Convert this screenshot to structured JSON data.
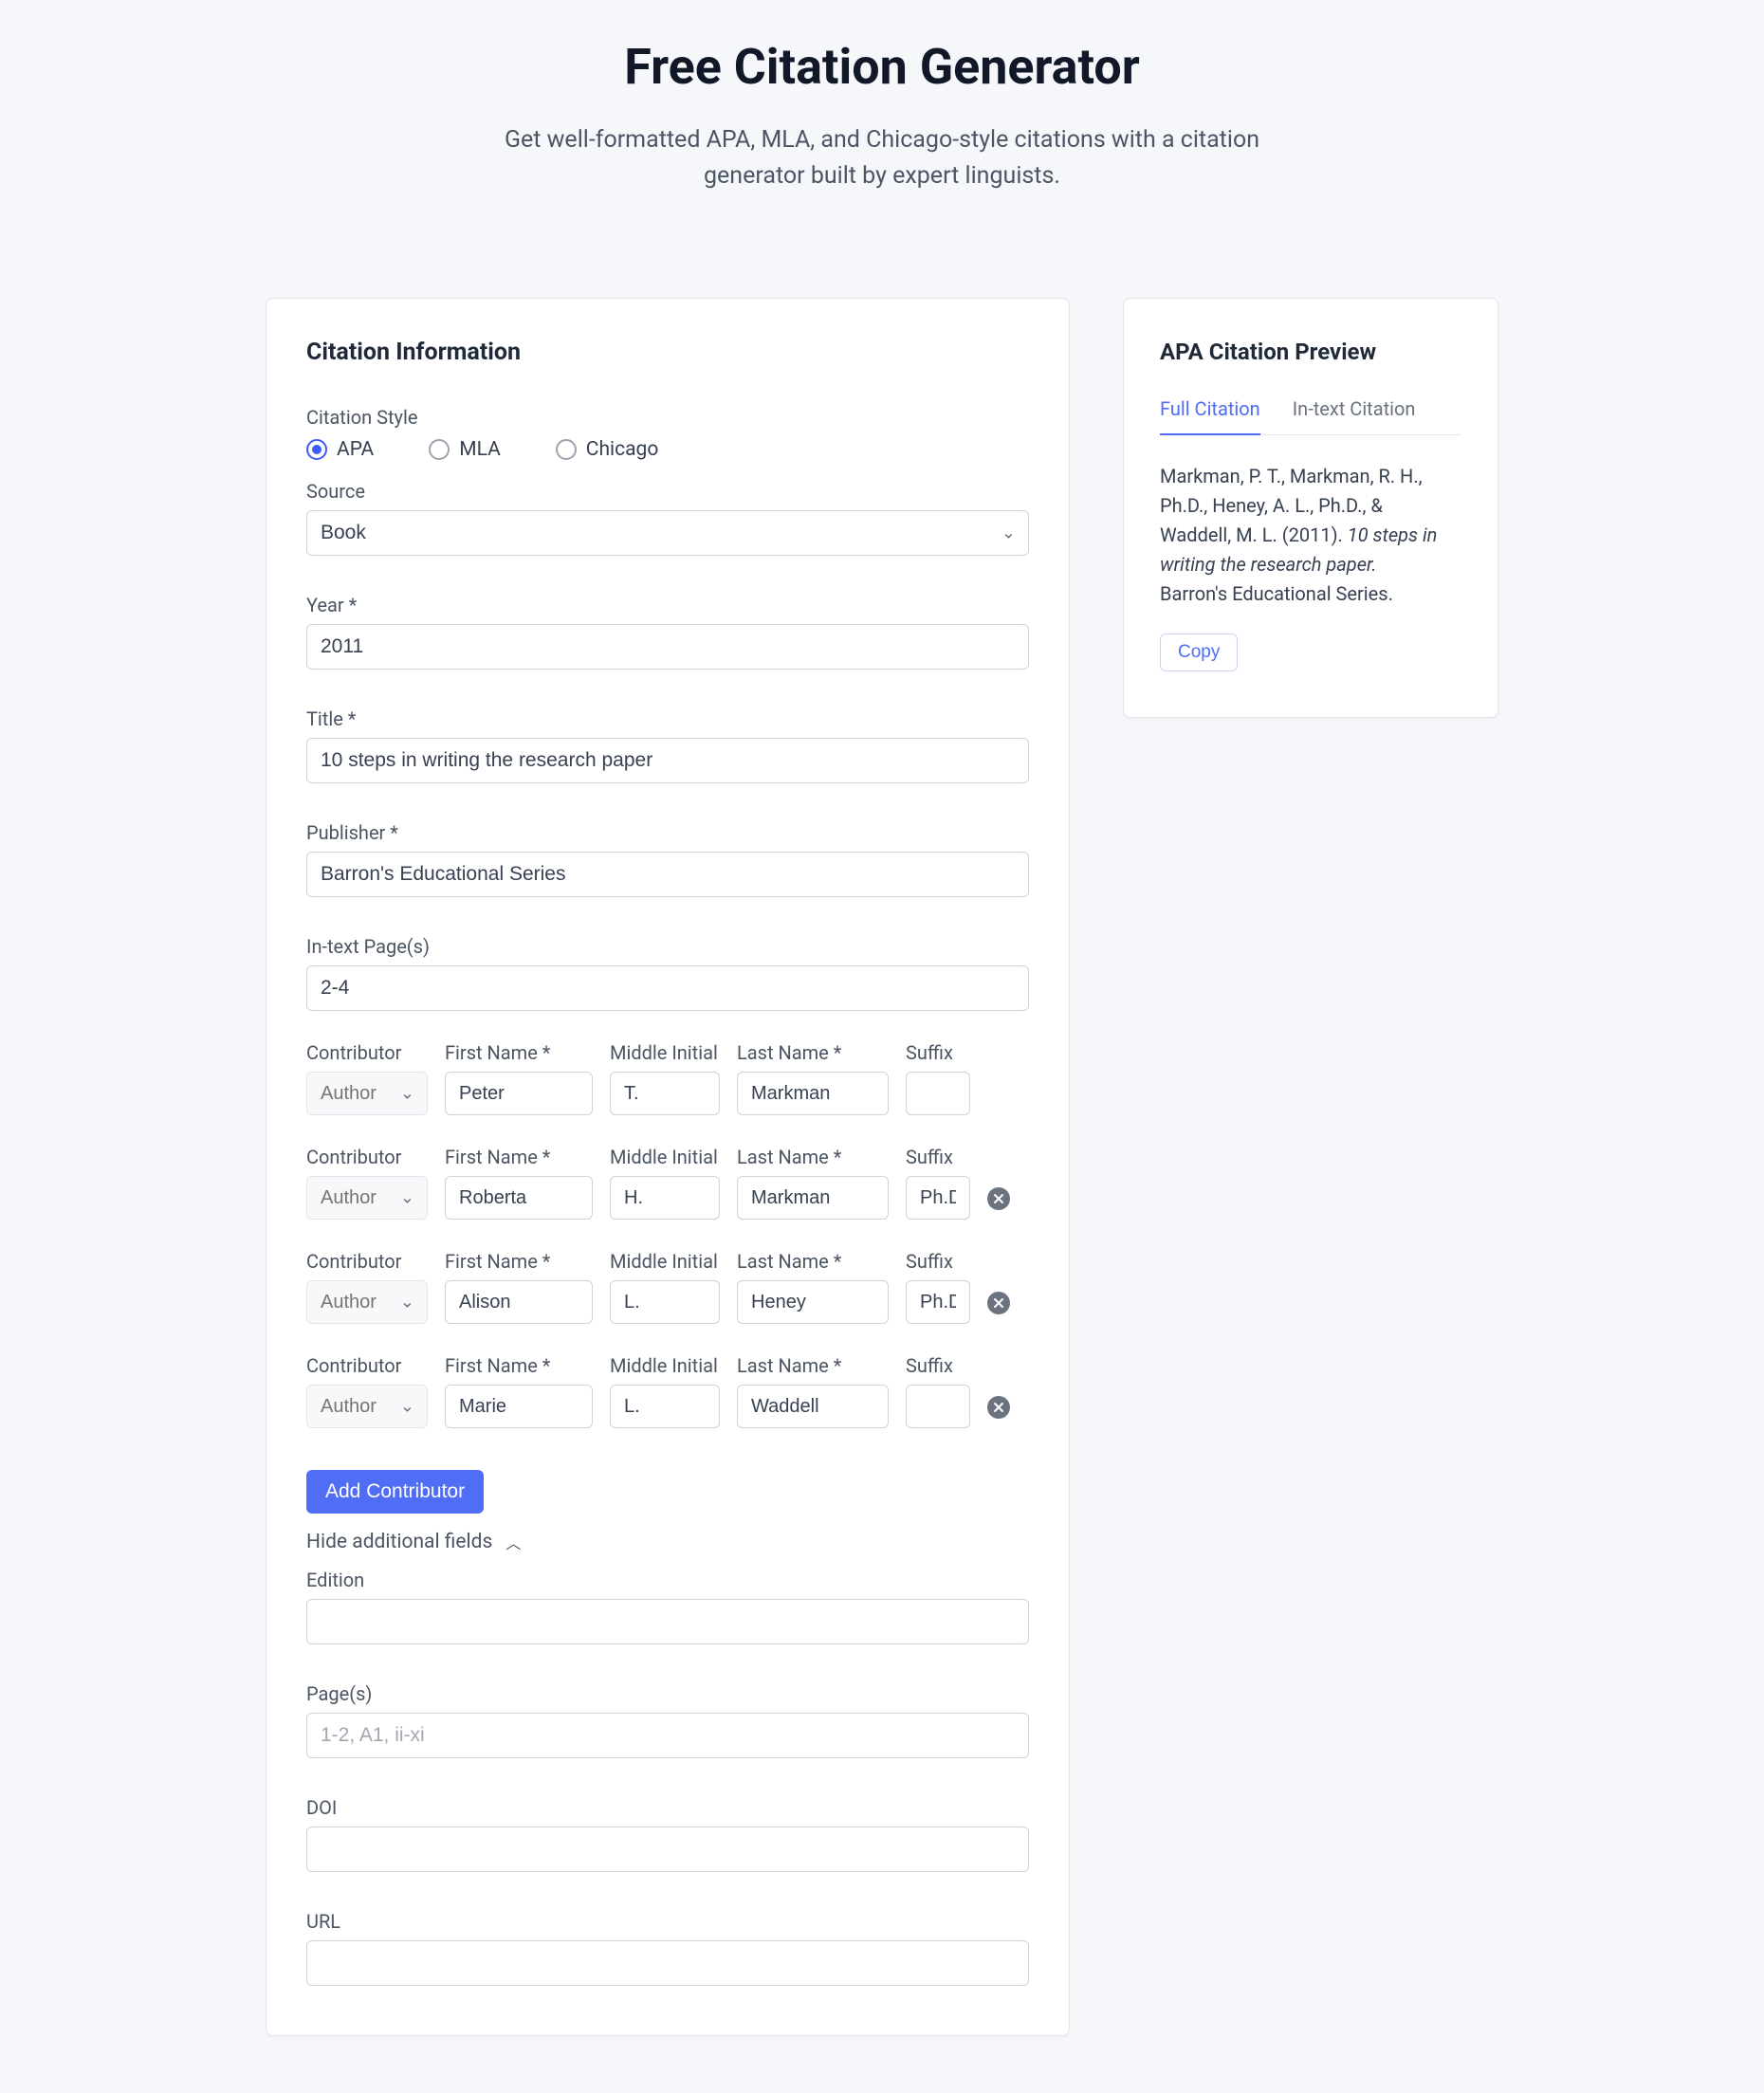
{
  "hero": {
    "title": "Free Citation Generator",
    "subtitle1": "Get well-formatted APA, MLA, and Chicago-style citations with a citation",
    "subtitle2": "generator built by expert linguists."
  },
  "form": {
    "heading": "Citation Information",
    "style_label": "Citation Style",
    "styles": {
      "apa": "APA",
      "mla": "MLA",
      "chicago": "Chicago"
    },
    "source_label": "Source",
    "source_value": "Book",
    "year_label": "Year *",
    "year_value": "2011",
    "title_label": "Title *",
    "title_value": "10 steps in writing the research paper",
    "publisher_label": "Publisher *",
    "publisher_value": "Barron's Educational Series",
    "intext_label": "In-text Page(s)",
    "intext_value": "2-4",
    "col": {
      "role": "Contributor",
      "first": "First Name *",
      "middle": "Middle Initial",
      "last": "Last Name *",
      "suffix": "Suffix"
    },
    "role_placeholder": "Author",
    "contributors": [
      {
        "first": "Peter",
        "middle": "T.",
        "last": "Markman",
        "suffix": "",
        "removable": false
      },
      {
        "first": "Roberta",
        "middle": "H.",
        "last": "Markman",
        "suffix": "Ph.D",
        "removable": true
      },
      {
        "first": "Alison",
        "middle": "L.",
        "last": "Heney",
        "suffix": "Ph.D",
        "removable": true
      },
      {
        "first": "Marie",
        "middle": "L.",
        "last": "Waddell",
        "suffix": "",
        "removable": true
      }
    ],
    "add_contributor": "Add Contributor",
    "toggle_additional": "Hide additional fields",
    "edition_label": "Edition",
    "edition_value": "",
    "pages_label": "Page(s)",
    "pages_placeholder": "1-2, A1, ii-xi",
    "doi_label": "DOI",
    "doi_value": "",
    "url_label": "URL",
    "url_value": ""
  },
  "preview": {
    "heading": "APA Citation Preview",
    "tab_full": "Full Citation",
    "tab_intext": "In-text Citation",
    "text_before": "Markman, P. T., Markman, R. H., Ph.D., Heney, A. L., Ph.D., & Waddell, M. L. (2011). ",
    "text_italic": "10 steps in writing the research paper.",
    "text_after": " Barron's Educational Series.",
    "copy": "Copy"
  }
}
